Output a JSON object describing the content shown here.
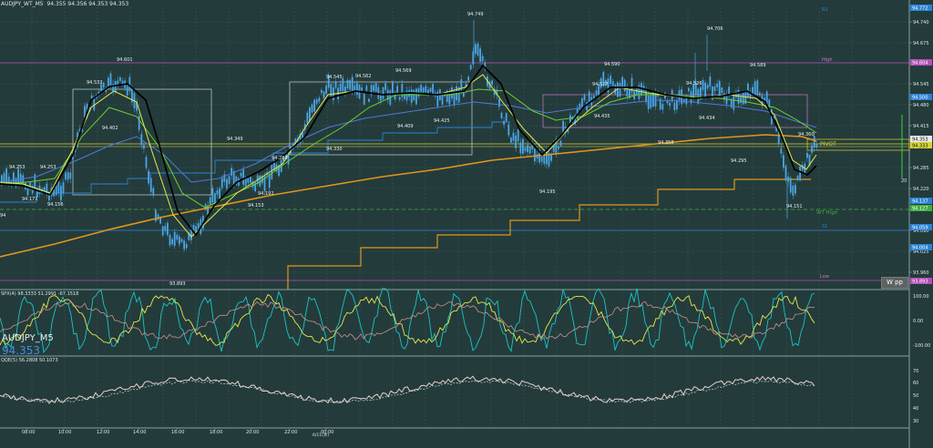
{
  "window": {
    "title": "AUDJPY_WT_M5",
    "ohlc": "94.355 94.356 94.353 94.353"
  },
  "price_axis": {
    "ticks": [
      "94.740",
      "94.675",
      "94.610",
      "94.545",
      "94.480",
      "94.415",
      "94.350",
      "94.285",
      "94.220",
      "94.155",
      "94.090",
      "94.025",
      "93.960"
    ],
    "tags": [
      {
        "text": "94.772",
        "color": "#2a83d6"
      },
      {
        "text": "94.604",
        "color": "#b34fb5"
      },
      {
        "text": "94.500",
        "color": "#2a83d6"
      },
      {
        "text": "94.353",
        "color": "#e8e8e8"
      },
      {
        "text": "94.333",
        "color": "#d7d43a"
      },
      {
        "text": "94.137",
        "color": "#2a83d6"
      },
      {
        "text": "94.127",
        "color": "#3fae3f"
      },
      {
        "text": "94.059",
        "color": "#2a83d6"
      },
      {
        "text": "94.004",
        "color": "#2a83d6"
      },
      {
        "text": "93.893",
        "color": "#b34fb5"
      }
    ]
  },
  "level_labels": {
    "r1": "R1",
    "high": "High",
    "pivot": "PIVOT",
    "wt_high": "WT High",
    "s1": "S1",
    "low": "Low",
    "range": "20"
  },
  "price_labels": [
    {
      "text": "94.749",
      "dx": 0,
      "dy": 0
    },
    {
      "text": "94.706"
    },
    {
      "text": "94.601"
    },
    {
      "text": "94.590"
    },
    {
      "text": "94.589"
    },
    {
      "text": "94.569"
    },
    {
      "text": "94.545"
    },
    {
      "text": "94.562"
    },
    {
      "text": "94.532"
    },
    {
      "text": "94.527"
    },
    {
      "text": "94.526"
    },
    {
      "text": "94.425"
    },
    {
      "text": "94.409"
    },
    {
      "text": "94.435"
    },
    {
      "text": "94.434"
    },
    {
      "text": "94.402"
    },
    {
      "text": "94.349"
    },
    {
      "text": "94.330"
    },
    {
      "text": "94.358"
    },
    {
      "text": "94.360"
    },
    {
      "text": "94.295"
    },
    {
      "text": "94.284"
    },
    {
      "text": "94.253"
    },
    {
      "text": "94.253"
    },
    {
      "text": "94.192"
    },
    {
      "text": "94.195"
    },
    {
      "text": "94.171"
    },
    {
      "text": "94.156"
    },
    {
      "text": "94.153"
    },
    {
      "text": "94.151"
    },
    {
      "text": "93.893"
    },
    {
      "text": "94"
    }
  ],
  "osc1": {
    "label": "SPX(4) 98.3333 51.2991 -67.1518",
    "ticks": [
      "100.00",
      "0.00",
      "-100.00"
    ]
  },
  "osc2": {
    "label": "QQE(5) 56.2808 50.1073",
    "ticks": [
      "70",
      "60",
      "50",
      "40",
      "30"
    ]
  },
  "symbol_big": "AUDJPY_M5",
  "price_big": "94.353",
  "wpp_button": "W pp",
  "time_axis": {
    "labels": [
      "08:00",
      "10:00",
      "12:00",
      "14:00",
      "16:00",
      "18:00",
      "20:00",
      "22:00",
      "00:00"
    ],
    "date": "6/11(水)"
  },
  "colors": {
    "bg": "#243b3b",
    "grid": "#3d5656",
    "candle": "#49a6e6",
    "ema_fast": "#000000",
    "ema_yellow": "#e6e84a",
    "ema_green": "#6ccf2c",
    "ema_blue": "#4e7ad8",
    "ema_orange": "#e0961e",
    "pivot_line": "#d7d43a",
    "high_line": "#b34fb5",
    "wt_line": "#3fae3f",
    "s1_line": "#2a83d6"
  }
}
